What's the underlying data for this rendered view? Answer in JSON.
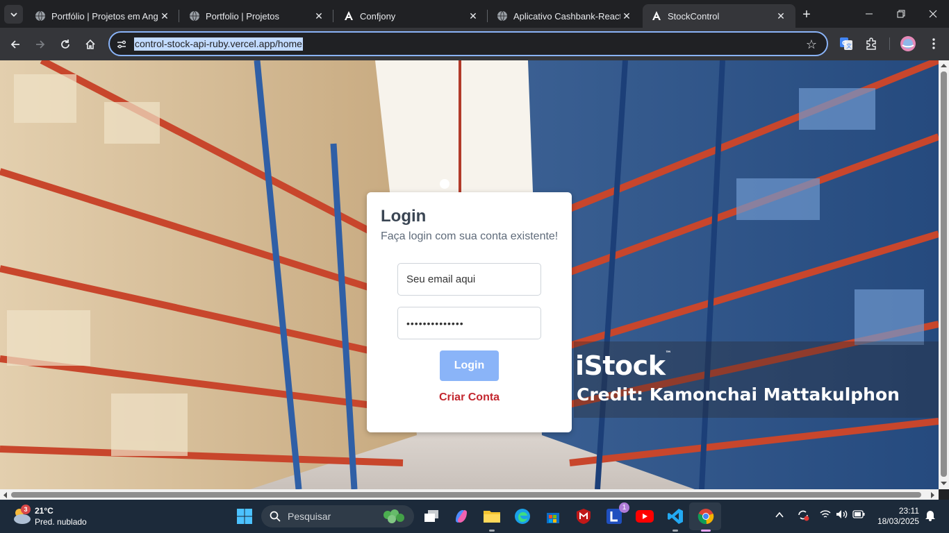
{
  "browser": {
    "tabs": [
      {
        "title": "Portfólio | Projetos em Angular",
        "favicon": "globe-icon",
        "active": false
      },
      {
        "title": "Portfolio | Projetos",
        "favicon": "globe-icon",
        "active": false
      },
      {
        "title": "Confjony",
        "favicon": "angular-icon",
        "active": false
      },
      {
        "title": "Aplicativo Cashbank-React",
        "favicon": "globe-icon",
        "active": false
      },
      {
        "title": "StockControl",
        "favicon": "angular-icon",
        "active": true
      }
    ],
    "url": "control-stock-api-ruby.vercel.app/home"
  },
  "page": {
    "background": {
      "credit_logo": "iStock",
      "credit_logo_tm": "™",
      "credit_text": "Credit: Kamonchai Mattakulphon"
    },
    "login": {
      "title": "Login",
      "subtitle": "Faça login com sua conta existente!",
      "email_placeholder": "Seu email aqui",
      "password_value": "••••••••••••••",
      "login_button": "Login",
      "create_account": "Criar Conta"
    },
    "colors": {
      "button_bg": "#8ab4f8",
      "link_color": "#c3272f",
      "title_color": "#3a4553"
    }
  },
  "taskbar": {
    "weather": {
      "badge": "3",
      "temp": "21°C",
      "condition": "Pred. nublado"
    },
    "search_placeholder": "Pesquisar",
    "time": "23:11",
    "date": "18/03/2025",
    "notification_badge": "1"
  }
}
